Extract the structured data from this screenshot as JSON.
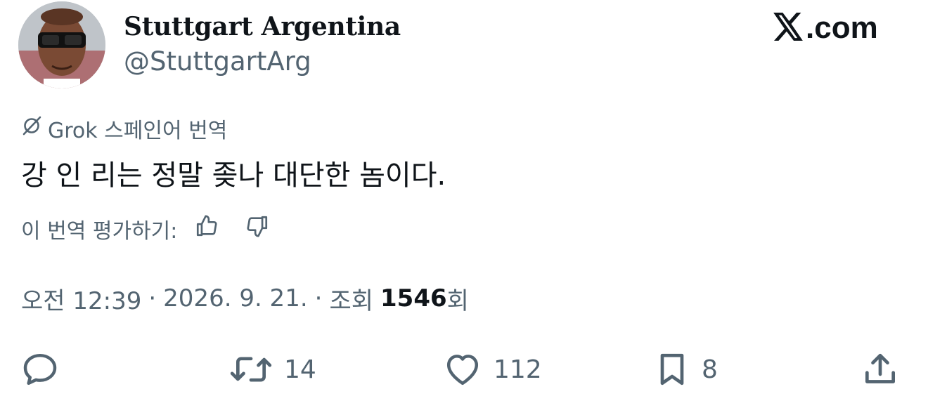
{
  "tweet": {
    "display_name": "Stuttgart Argentina",
    "handle": "@StuttgartArg",
    "brand": ".com",
    "translation": {
      "label": "Grok 스페인어 번역"
    },
    "text": "강 인 리는 정말 좆나 대단한 놈이다.",
    "rate": {
      "label": "이 번역 평가하기:"
    },
    "meta": {
      "time": "오전 12:39",
      "separator": "·",
      "date": "2026. 9. 21.",
      "views_prefix": "조회",
      "views_count": "1546",
      "views_suffix": "회"
    },
    "actions": {
      "reply_count": "",
      "retweet_count": "14",
      "like_count": "112",
      "bookmark_count": "8"
    }
  },
  "icons": {
    "grok": "grok-icon",
    "x_logo": "x-logo-icon",
    "reply": "reply-icon",
    "retweet": "retweet-icon",
    "like": "heart-icon",
    "bookmark": "bookmark-icon",
    "share": "share-icon",
    "thumbs_up": "thumbs-up-icon",
    "thumbs_down": "thumbs-down-icon"
  },
  "colors": {
    "text_primary": "#0f1419",
    "text_secondary": "#536471",
    "background": "#ffffff"
  }
}
